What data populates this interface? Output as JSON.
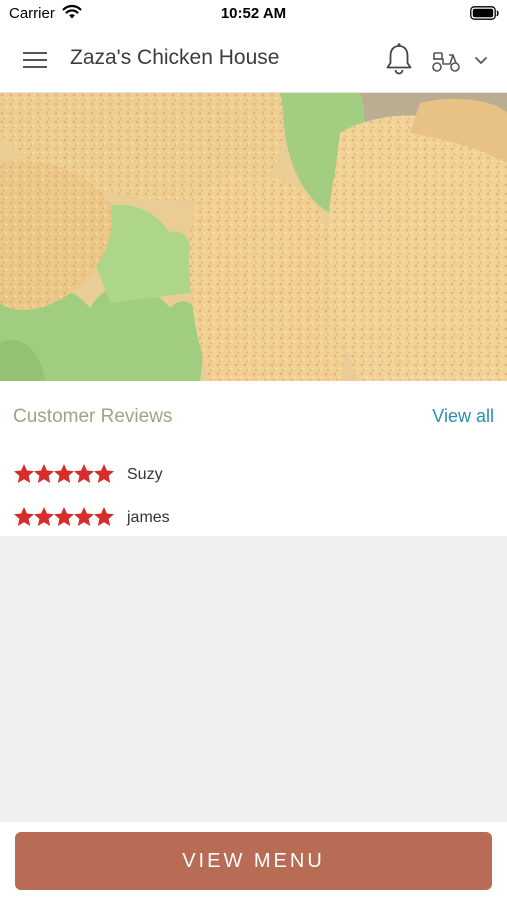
{
  "status_bar": {
    "carrier": "Carrier",
    "time": "10:52 AM",
    "icons": [
      "wifi-icon",
      "battery-icon"
    ]
  },
  "header": {
    "title": "Zaza's Chicken House",
    "icons": [
      "hamburger-menu-icon",
      "bell-icon",
      "scooter-icon",
      "chevron-down-icon"
    ]
  },
  "hero": {
    "description_icon": "fried-chicken-photo"
  },
  "reviews": {
    "title": "Customer Reviews",
    "view_all_label": "View all",
    "star_color": "#d62c2c",
    "items": [
      {
        "name": "Suzy",
        "rating": 5
      },
      {
        "name": "james",
        "rating": 5
      }
    ]
  },
  "footer": {
    "view_menu_label": "VIEW MENU",
    "button_color": "#b86b55"
  }
}
